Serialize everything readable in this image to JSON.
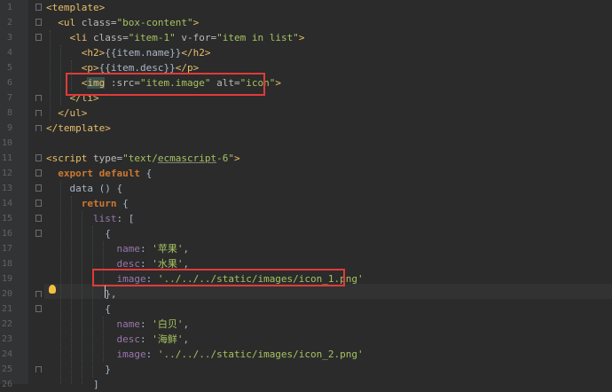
{
  "editor": {
    "lines": [
      {
        "num": "1",
        "html": "<span class='tag'>&lt;template&gt;</span>"
      },
      {
        "num": "2",
        "html": "  <span class='tag'>&lt;ul </span><span class='attr'>class=</span><span class='str'>\"box-content\"</span><span class='tag'>&gt;</span>"
      },
      {
        "num": "3",
        "html": "    <span class='tag'>&lt;li </span><span class='attr'>class=</span><span class='str'>\"item-1\"</span><span class='attr'> v-for=</span><span class='str'>\"item in list\"</span><span class='tag'>&gt;</span>"
      },
      {
        "num": "4",
        "html": "      <span class='tag'>&lt;h2&gt;</span><span class='plain'>{{item.name}}</span><span class='tag'>&lt;/h2&gt;</span>"
      },
      {
        "num": "5",
        "html": "      <span class='tag'>&lt;p&gt;</span><span class='plain'>{{item.desc}}</span><span class='tag'>&lt;/p&gt;</span>"
      },
      {
        "num": "6",
        "html": "      <span class='tag'>&lt;</span><span class='tag hl-img'>img</span><span class='attr'> :src=</span><span class='str'>\"item.image\"</span><span class='attr'> alt=</span><span class='str'>\"icon\"</span><span class='tag'>&gt;</span>"
      },
      {
        "num": "7",
        "html": "    <span class='tag'>&lt;/li&gt;</span>"
      },
      {
        "num": "8",
        "html": "  <span class='tag'>&lt;/ul&gt;</span>"
      },
      {
        "num": "9",
        "html": "<span class='tag'>&lt;/template&gt;</span>"
      },
      {
        "num": "10",
        "html": ""
      },
      {
        "num": "11",
        "html": "<span class='tag'>&lt;script </span><span class='attr'>type=</span><span class='str'>\"text/<span class='underline'>ecmascript</span>-6\"</span><span class='tag'>&gt;</span>"
      },
      {
        "num": "12",
        "html": "  <span class='kw'>export default </span><span class='plain'>{</span>"
      },
      {
        "num": "13",
        "html": "    <span class='plain'>data () {</span>"
      },
      {
        "num": "14",
        "html": "      <span class='kw'>return </span><span class='plain'>{</span>"
      },
      {
        "num": "15",
        "html": "        <span class='prop'>list</span><span class='plain'>: [</span>"
      },
      {
        "num": "16",
        "html": "          <span class='plain'>{</span>"
      },
      {
        "num": "17",
        "html": "            <span class='prop'>name</span><span class='plain'>: </span><span class='str'>'苹果'</span><span class='plain'>,</span>"
      },
      {
        "num": "18",
        "html": "            <span class='prop'>desc</span><span class='plain'>: </span><span class='str'>'水果'</span><span class='plain'>,</span>"
      },
      {
        "num": "19",
        "html": "            <span class='prop'>image</span><span class='plain'>: </span><span class='str'>'../../../static/images/icon_1.png'</span>"
      },
      {
        "num": "20",
        "html": "          <span class='plain'>},</span>"
      },
      {
        "num": "21",
        "html": "          <span class='plain'>{</span>"
      },
      {
        "num": "22",
        "html": "            <span class='prop'>name</span><span class='plain'>: </span><span class='str'>'白贝'</span><span class='plain'>,</span>"
      },
      {
        "num": "23",
        "html": "            <span class='prop'>desc</span><span class='plain'>: </span><span class='str'>'海鲜'</span><span class='plain'>,</span>"
      },
      {
        "num": "24",
        "html": "            <span class='prop'>image</span><span class='plain'>: </span><span class='str'>'../../../static/images/icon_2.png'</span>"
      },
      {
        "num": "25",
        "html": "          <span class='plain'>}</span>"
      },
      {
        "num": "26",
        "html": "        <span class='plain'>]</span>"
      }
    ]
  }
}
